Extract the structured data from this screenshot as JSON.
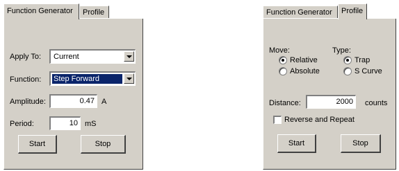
{
  "left_panel": {
    "tabs": [
      "Function Generator",
      "Profile"
    ],
    "apply_to_label": "Apply To:",
    "apply_to_value": "Current",
    "function_label": "Function:",
    "function_value": "Step Forward",
    "amplitude_label": "Amplitude:",
    "amplitude_value": "0.47",
    "amplitude_unit": "A",
    "period_label": "Period:",
    "period_value": "10",
    "period_unit": "mS",
    "start_label": "Start",
    "stop_label": "Stop"
  },
  "right_panel": {
    "tabs": [
      "Function Generator",
      "Profile"
    ],
    "move_label": "Move:",
    "move_options": [
      "Relative",
      "Absolute"
    ],
    "move_selected": "Relative",
    "type_label": "Type:",
    "type_options": [
      "Trap",
      "S Curve"
    ],
    "type_selected": "Trap",
    "distance_label": "Distance:",
    "distance_value": "2000",
    "distance_unit": "counts",
    "reverse_repeat_label": "Reverse and Repeat",
    "reverse_repeat_checked": false,
    "start_label": "Start",
    "stop_label": "Stop"
  }
}
